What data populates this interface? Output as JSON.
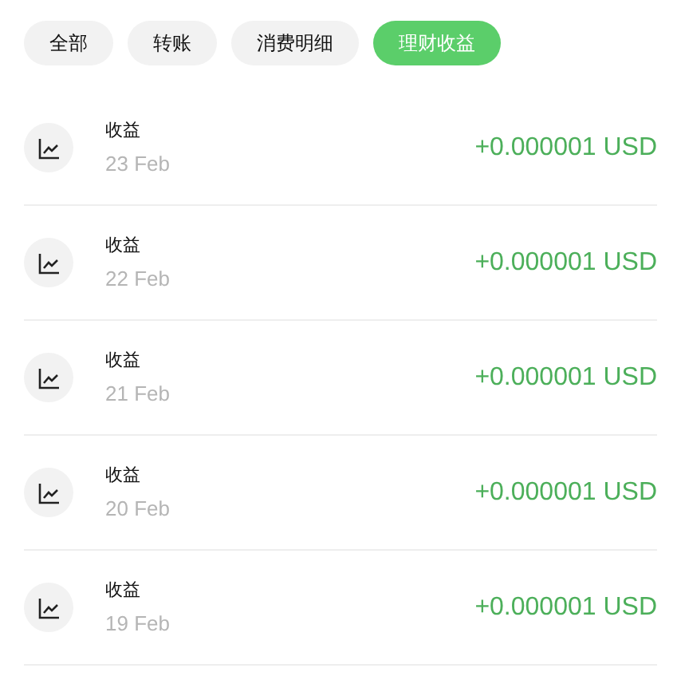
{
  "filters": [
    {
      "label": "全部",
      "selected": false
    },
    {
      "label": "转账",
      "selected": false
    },
    {
      "label": "消费明细",
      "selected": false
    },
    {
      "label": "理财收益",
      "selected": true
    }
  ],
  "transactions": [
    {
      "title": "收益",
      "date": "23 Feb",
      "amount": "+0.000001 USD"
    },
    {
      "title": "收益",
      "date": "22 Feb",
      "amount": "+0.000001 USD"
    },
    {
      "title": "收益",
      "date": "21 Feb",
      "amount": "+0.000001 USD"
    },
    {
      "title": "收益",
      "date": "20 Feb",
      "amount": "+0.000001 USD"
    },
    {
      "title": "收益",
      "date": "19 Feb",
      "amount": "+0.000001 USD"
    }
  ]
}
